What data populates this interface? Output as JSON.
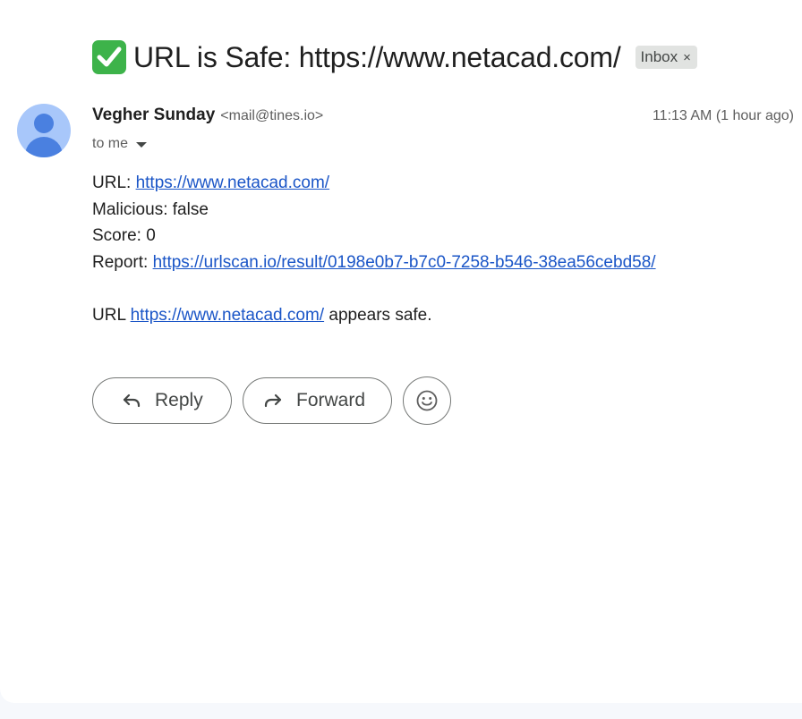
{
  "email": {
    "subject": "URL is Safe: https://www.netacad.com/",
    "subject_icon": "white-check-mark-icon",
    "label": "Inbox",
    "label_remove_glyph": "×",
    "sender_name": "Vegher Sunday",
    "sender_email": "<mail@tines.io>",
    "timestamp": "11:13 AM (1 hour ago)",
    "recipient": "to me",
    "body": {
      "url_label": "URL: ",
      "url_link": "https://www.netacad.com/",
      "malicious": "Malicious: false",
      "score": "Score: 0",
      "report_label": "Report: ",
      "report_link": "https://urlscan.io/result/0198e0b7-b7c0-7258-b546-38ea56cebd58/",
      "summary_prefix": "URL ",
      "summary_link": "https://www.netacad.com/",
      "summary_suffix": " appears safe."
    }
  },
  "actions": {
    "reply_label": "Reply",
    "forward_label": "Forward",
    "emoji_icon": "smiley-face-icon"
  },
  "colors": {
    "link": "#1a55c7",
    "check_badge": "#3db34a",
    "avatar_bg": "#a8c7fa",
    "avatar_fg": "#4a80e0",
    "chip_bg": "#e1e3e1"
  }
}
